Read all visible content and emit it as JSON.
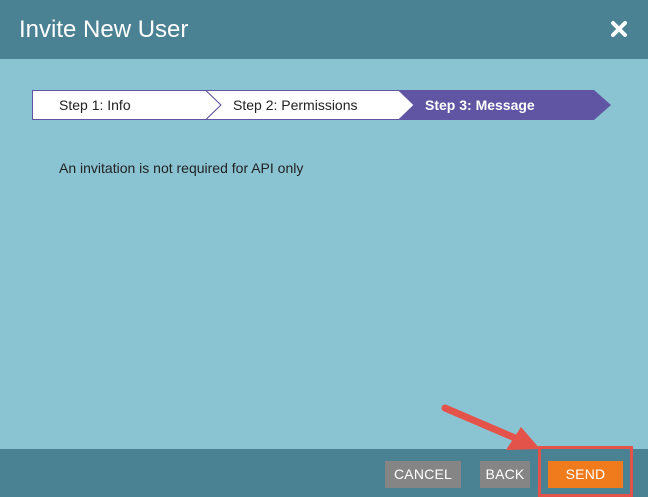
{
  "dialog": {
    "title": "Invite New User",
    "close_icon": "close-icon"
  },
  "stepper": {
    "steps": [
      {
        "label": "Step 1: Info",
        "state": "completed"
      },
      {
        "label": "Step 2: Permissions",
        "state": "completed"
      },
      {
        "label": "Step 3: Message",
        "state": "active"
      }
    ],
    "active_color": "#5f55a3"
  },
  "content": {
    "message": "An invitation is not required for API only"
  },
  "footer": {
    "cancel_label": "CANCEL",
    "back_label": "BACK",
    "send_label": "SEND"
  },
  "colors": {
    "header": "#4a8294",
    "body": "#8ac3d2",
    "send_button": "#f07b1c",
    "secondary_button": "#858585",
    "annotation": "#e4534a"
  },
  "annotation": {
    "arrow_icon": "arrow-pointer-icon",
    "highlight": "send-button-highlight"
  }
}
